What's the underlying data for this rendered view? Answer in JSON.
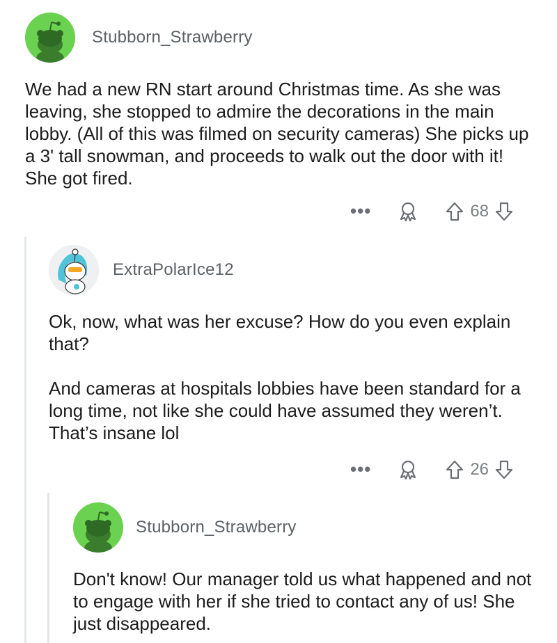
{
  "comments": [
    {
      "username": "Stubborn_Strawberry",
      "avatar_icon": "snoo-avatar-icon",
      "avatar_color": "#6bd150",
      "paragraphs": [
        "We had a new RN start around Christmas time. As she was leaving, she stopped to admire the decorations in the main lobby. (All of this was filmed on security cameras) She picks up a 3' tall snowman, and proceeds to walk out the door with it! She got fired."
      ],
      "more": "•••",
      "votes": "68"
    },
    {
      "username": "ExtraPolarIce12",
      "avatar_icon": "custom-snoo-avatar-icon",
      "paragraphs": [
        "Ok, now, what was her excuse?  How do you even explain that?",
        "And cameras at hospitals lobbies have been standard for a long time, not like she could have assumed they weren’t. That’s insane lol"
      ],
      "more": "•••",
      "votes": "26"
    },
    {
      "username": "Stubborn_Strawberry",
      "avatar_icon": "snoo-avatar-icon",
      "avatar_color": "#6bd150",
      "paragraphs": [
        "Don't know! Our manager told us what happened and not to engage with her if she tried to contact any of us! She just disappeared."
      ]
    }
  ]
}
